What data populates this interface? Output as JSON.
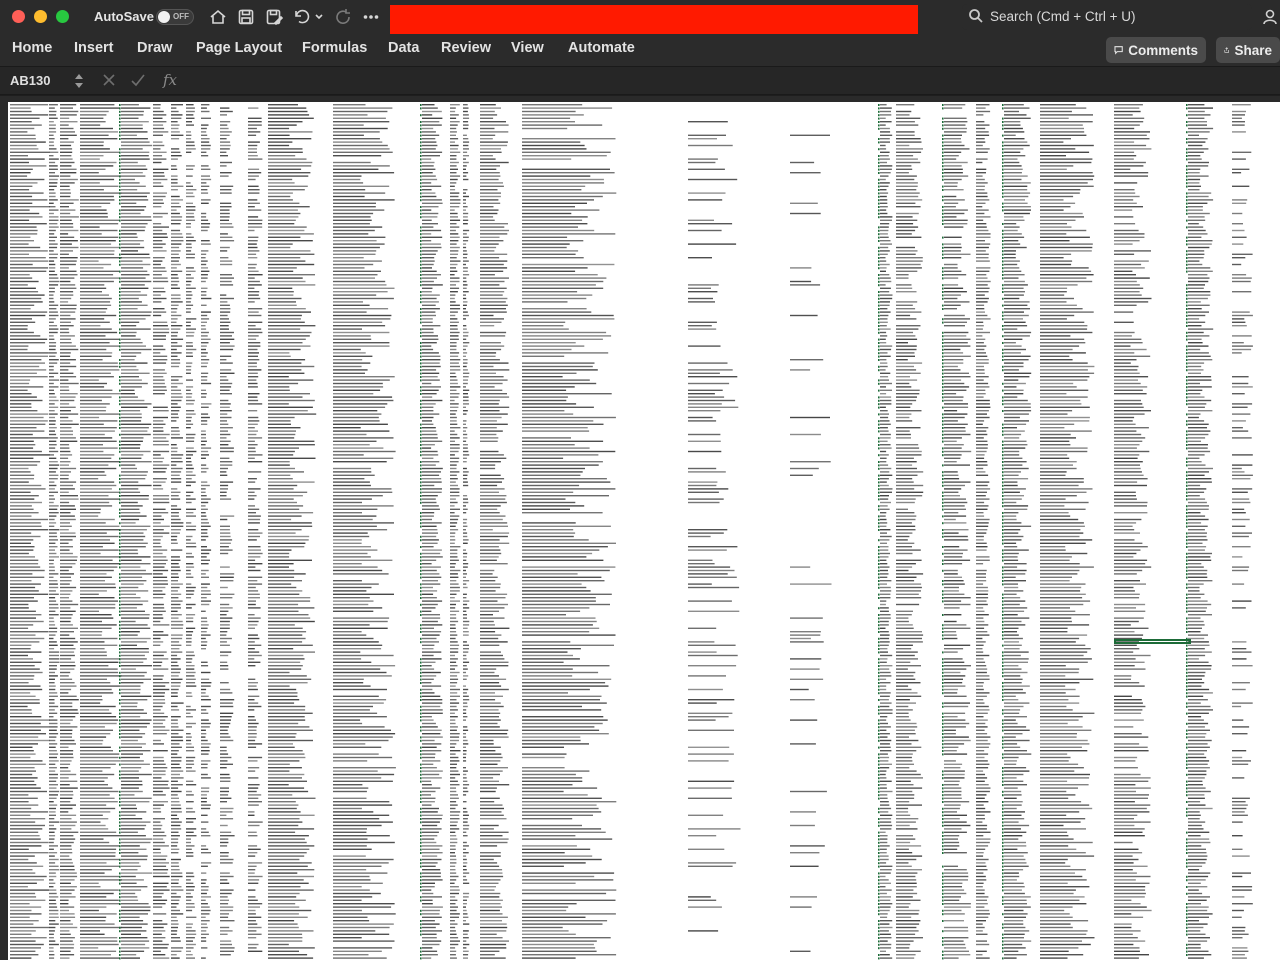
{
  "window": {
    "autosave_label": "AutoSave",
    "autosave_state": "OFF",
    "search_placeholder": "Search (Cmd + Ctrl + U)"
  },
  "ribbon": {
    "tabs": [
      "Home",
      "Insert",
      "Draw",
      "Page Layout",
      "Formulas",
      "Data",
      "Review",
      "View",
      "Automate"
    ],
    "comments_label": "Comments",
    "share_label": "Share"
  },
  "formula_bar": {
    "name_box": "AB130",
    "fx_label": "fx",
    "formula_value": ""
  },
  "sheet": {
    "selected_cell": "AB130",
    "accent_green": "#1d6b38",
    "text_color": "#3a3a3a"
  }
}
